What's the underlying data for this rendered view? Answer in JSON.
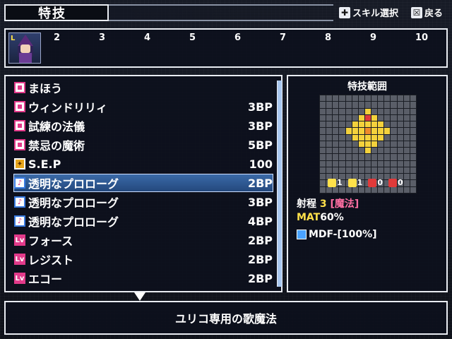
{
  "header": {
    "title": "特技",
    "hints": [
      {
        "icon": "dpad-icon",
        "key_glyph": "✚",
        "label": "スキル選択"
      },
      {
        "icon": "x-button-icon",
        "key_glyph": "☒",
        "label": "戻る"
      }
    ]
  },
  "party": {
    "active_badge": "L",
    "slots": [
      "2",
      "3",
      "4",
      "5",
      "6",
      "7",
      "8",
      "9",
      "10"
    ]
  },
  "skills": [
    {
      "icon": "magic-category-icon",
      "name": "まほう",
      "cost": ""
    },
    {
      "icon": "magic-skill-icon",
      "name": "ウィンドリリィ",
      "cost": "3BP"
    },
    {
      "icon": "magic-skill-icon",
      "name": "試練の法儀",
      "cost": "3BP"
    },
    {
      "icon": "magic-skill-icon",
      "name": "禁忌の魔術",
      "cost": "5BP"
    },
    {
      "icon": "special-skill-icon",
      "name": "S.E.P",
      "cost": "100"
    },
    {
      "icon": "song-skill-icon",
      "name": "透明なプロローグ",
      "cost": "2BP"
    },
    {
      "icon": "song-plus1-icon",
      "name": "透明なプロローグ",
      "cost": "3BP"
    },
    {
      "icon": "song-plus2-icon",
      "name": "透明なプロローグ",
      "cost": "4BP"
    },
    {
      "icon": "level-skill-icon",
      "name": "フォース",
      "cost": "2BP"
    },
    {
      "icon": "level-skill-icon",
      "name": "レジスト",
      "cost": "2BP"
    },
    {
      "icon": "level-skill-icon",
      "name": "エコー",
      "cost": "2BP"
    }
  ],
  "selected_index": 5,
  "range_panel": {
    "title": "特技範囲",
    "stat_counts": [
      "1",
      "1",
      "0",
      "0"
    ],
    "range_label": "射程",
    "range_value": "3",
    "range_type": "[魔法]",
    "mat_label": "MAT",
    "mat_value": "60%",
    "mdf_text": "MDF-[100%]"
  },
  "description": "ユリコ専用の歌魔法",
  "colors": {
    "selection": "#2f5c98",
    "accent_magic": "#e23a8a",
    "range_yellow": "#f4d23c",
    "range_orange": "#ef8a2a",
    "range_red": "#e03a3a"
  }
}
